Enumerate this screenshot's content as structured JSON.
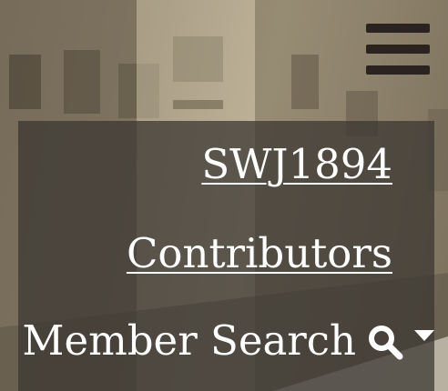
{
  "background": {
    "image": "historic-street-photo"
  },
  "header": {
    "menu_icon": "hamburger-icon"
  },
  "menu": {
    "items": [
      {
        "label": "SWJ1894"
      },
      {
        "label": "Contributors"
      },
      {
        "label": "Member Search",
        "icon": "search-icon",
        "dropdown_icon": "caret-down-icon"
      }
    ]
  },
  "colors": {
    "text": "#ffffff",
    "menu_bg": "#3a3632",
    "hamburger": "#2b2320"
  }
}
